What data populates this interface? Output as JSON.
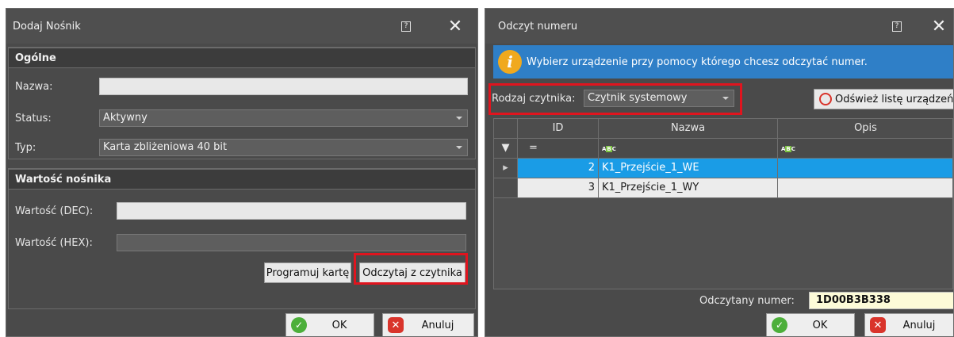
{
  "left_dialog": {
    "title": "Dodaj Nośnik",
    "help_glyph": "?",
    "close_glyph": "✕",
    "general": {
      "header": "Ogólne",
      "name_label": "Nazwa:",
      "name_value": "",
      "status_label": "Status:",
      "status_value": "Aktywny",
      "type_label": "Typ:",
      "type_value": "Karta zbliżeniowa 40 bit"
    },
    "carrier": {
      "header": "Wartość nośnika",
      "dec_label": "Wartość (DEC):",
      "dec_value": "",
      "hex_label": "Wartość (HEX):",
      "hex_value": "",
      "program_label": "Programuj kartę",
      "read_label": "Odczytaj z czytnika"
    },
    "ok_label": "OK",
    "cancel_label": "Anuluj"
  },
  "right_dialog": {
    "title": "Odczyt numeru",
    "help_glyph": "?",
    "close_glyph": "✕",
    "info_text": "Wybierz urządzenie przy pomocy którego chcesz odczytać numer.",
    "reader_type_label": "Rodzaj czytnika:",
    "reader_type_value": "Czytnik systemowy",
    "refresh_label": "Odśwież listę urządzeń",
    "columns": [
      "ID",
      "Nazwa",
      "Opis"
    ],
    "filter_equals": "=",
    "rows": [
      {
        "id": "2",
        "name": "K1_Przejście_1_WE",
        "desc": ""
      },
      {
        "id": "3",
        "name": "K1_Przejście_1_WY",
        "desc": ""
      }
    ],
    "read_number_label": "Odczytany numer:",
    "read_number_value": "1D00B3B338",
    "ok_label": "OK",
    "cancel_label": "Anuluj"
  },
  "colors": {
    "selection": "#1a9ce6",
    "highlight_frame": "#e0141e",
    "info_bar": "#2f7fc7"
  }
}
